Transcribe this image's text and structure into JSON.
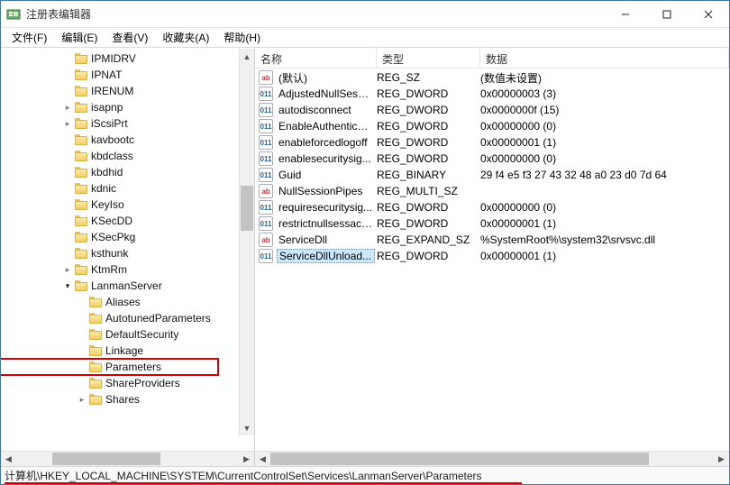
{
  "window": {
    "title": "注册表编辑器"
  },
  "menubar": [
    {
      "label": "文件(F)"
    },
    {
      "label": "编辑(E)"
    },
    {
      "label": "查看(V)"
    },
    {
      "label": "收藏夹(A)"
    },
    {
      "label": "帮助(H)"
    }
  ],
  "tree": {
    "items": [
      {
        "depth": 8,
        "exp": "none",
        "label": "IPMIDRV"
      },
      {
        "depth": 8,
        "exp": "none",
        "label": "IPNAT"
      },
      {
        "depth": 8,
        "exp": "none",
        "label": "IRENUM"
      },
      {
        "depth": 8,
        "exp": "closed",
        "label": "isapnp"
      },
      {
        "depth": 8,
        "exp": "closed",
        "label": "iScsiPrt"
      },
      {
        "depth": 8,
        "exp": "none",
        "label": "kavbootc"
      },
      {
        "depth": 8,
        "exp": "none",
        "label": "kbdclass"
      },
      {
        "depth": 8,
        "exp": "none",
        "label": "kbdhid"
      },
      {
        "depth": 8,
        "exp": "none",
        "label": "kdnic"
      },
      {
        "depth": 8,
        "exp": "none",
        "label": "KeyIso"
      },
      {
        "depth": 8,
        "exp": "none",
        "label": "KSecDD"
      },
      {
        "depth": 8,
        "exp": "none",
        "label": "KSecPkg"
      },
      {
        "depth": 8,
        "exp": "none",
        "label": "ksthunk"
      },
      {
        "depth": 8,
        "exp": "closed",
        "label": "KtmRm"
      },
      {
        "depth": 8,
        "exp": "open",
        "label": "LanmanServer"
      },
      {
        "depth": 9,
        "exp": "none",
        "label": "Aliases"
      },
      {
        "depth": 9,
        "exp": "none",
        "label": "AutotunedParameters"
      },
      {
        "depth": 9,
        "exp": "none",
        "label": "DefaultSecurity"
      },
      {
        "depth": 9,
        "exp": "none",
        "label": "Linkage"
      },
      {
        "depth": 9,
        "exp": "none",
        "label": "Parameters",
        "highlight": true
      },
      {
        "depth": 9,
        "exp": "none",
        "label": "ShareProviders"
      },
      {
        "depth": 9,
        "exp": "closed",
        "label": "Shares"
      }
    ]
  },
  "columns": {
    "name": "名称",
    "type": "类型",
    "data": "数据"
  },
  "values": [
    {
      "icon": "str",
      "iconText": "ab",
      "name": "(默认)",
      "type": "REG_SZ",
      "data": "(数值未设置)"
    },
    {
      "icon": "bin",
      "iconText": "011",
      "name": "AdjustedNullSessi...",
      "type": "REG_DWORD",
      "data": "0x00000003 (3)"
    },
    {
      "icon": "bin",
      "iconText": "011",
      "name": "autodisconnect",
      "type": "REG_DWORD",
      "data": "0x0000000f (15)"
    },
    {
      "icon": "bin",
      "iconText": "011",
      "name": "EnableAuthenticat...",
      "type": "REG_DWORD",
      "data": "0x00000000 (0)"
    },
    {
      "icon": "bin",
      "iconText": "011",
      "name": "enableforcedlogoff",
      "type": "REG_DWORD",
      "data": "0x00000001 (1)"
    },
    {
      "icon": "bin",
      "iconText": "011",
      "name": "enablesecuritysig...",
      "type": "REG_DWORD",
      "data": "0x00000000 (0)"
    },
    {
      "icon": "bin",
      "iconText": "011",
      "name": "Guid",
      "type": "REG_BINARY",
      "data": "29 f4 e5 f3 27 43 32 48 a0 23 d0 7d 64"
    },
    {
      "icon": "str",
      "iconText": "ab",
      "name": "NullSessionPipes",
      "type": "REG_MULTI_SZ",
      "data": ""
    },
    {
      "icon": "bin",
      "iconText": "011",
      "name": "requiresecuritysig...",
      "type": "REG_DWORD",
      "data": "0x00000000 (0)"
    },
    {
      "icon": "bin",
      "iconText": "011",
      "name": "restrictnullsessacc...",
      "type": "REG_DWORD",
      "data": "0x00000001 (1)"
    },
    {
      "icon": "str",
      "iconText": "ab",
      "name": "ServiceDll",
      "type": "REG_EXPAND_SZ",
      "data": "%SystemRoot%\\system32\\srvsvc.dll"
    },
    {
      "icon": "bin",
      "iconText": "011",
      "name": "ServiceDllUnload...",
      "type": "REG_DWORD",
      "data": "0x00000001 (1)",
      "selected": true
    }
  ],
  "statusbar": {
    "path": "计算机\\HKEY_LOCAL_MACHINE\\SYSTEM\\CurrentControlSet\\Services\\LanmanServer\\Parameters"
  }
}
